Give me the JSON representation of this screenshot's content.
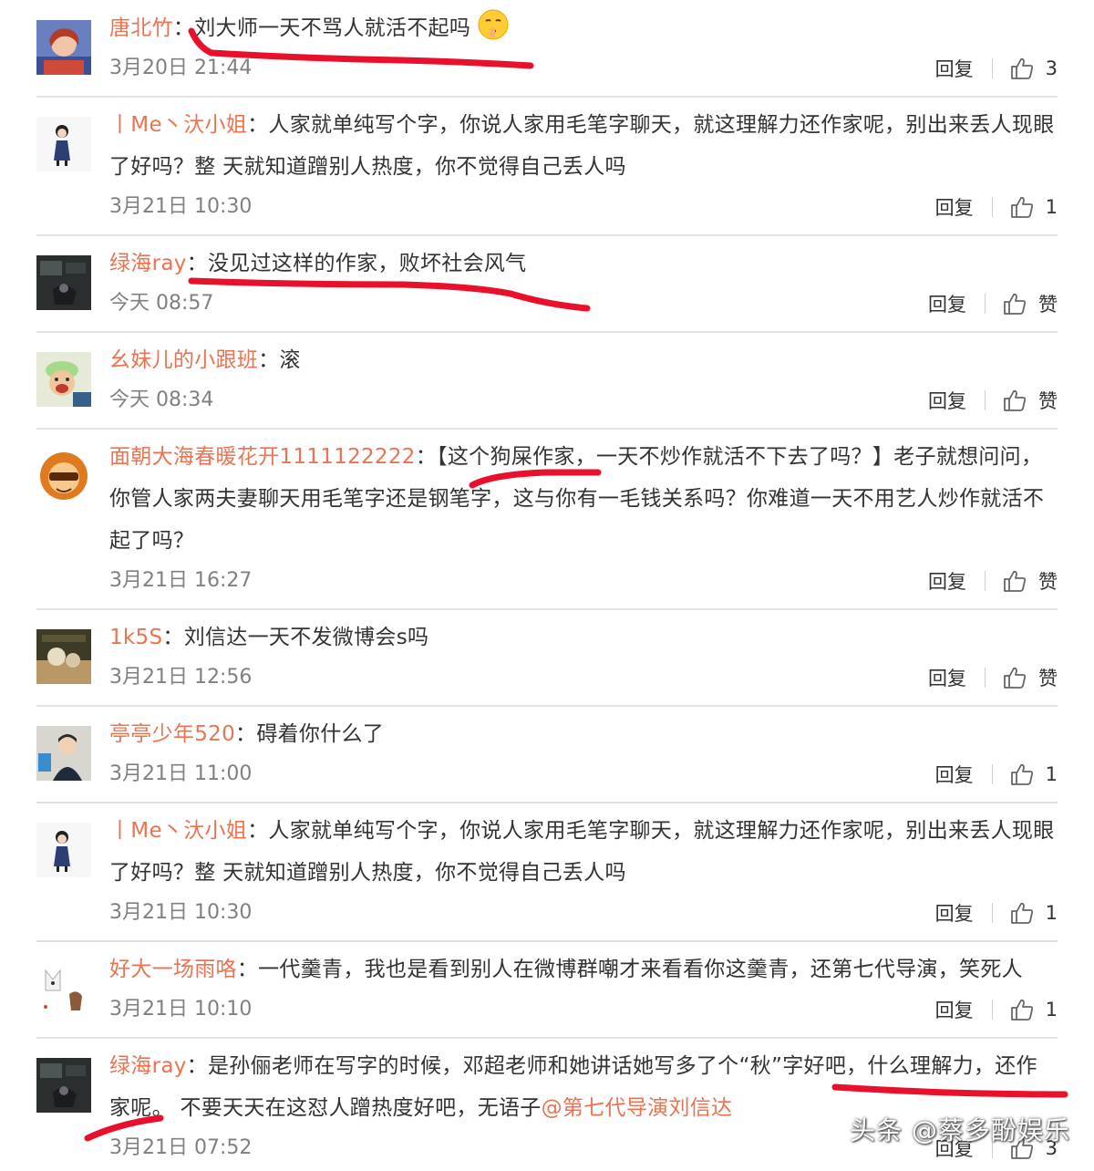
{
  "comments": [
    {
      "username": "唐北竹",
      "text": "刘大师一天不骂人就活不起吗",
      "emoji": "shushing-face-emoji",
      "time": "3月20日 21:44",
      "reply_label": "回复",
      "like_label": "3"
    },
    {
      "username": "丨Me丶汏小姐",
      "text": "人家就单纯写个字，你说人家用毛笔字聊天，就这理解力还作家呢，别出来丢人现眼了好吗？整 天就知道蹭别人热度，你不觉得自己丢人吗",
      "time": "3月21日 10:30",
      "reply_label": "回复",
      "like_label": "1"
    },
    {
      "username": "绿海ray",
      "text": "没见过这样的作家，败坏社会风气",
      "time": "今天 08:57",
      "reply_label": "回复",
      "like_label": "赞"
    },
    {
      "username": "幺妹儿的小跟班",
      "text": "滚",
      "time": "今天 08:34",
      "reply_label": "回复",
      "like_label": "赞"
    },
    {
      "username": "面朝大海春暖花开1111122222",
      "text": "【这个狗屎作家，一天不炒作就活不下去了吗？】老子就想问问，你管人家两夫妻聊天用毛笔字还是钢笔字，这与你有一毛钱关系吗？你难道一天不用艺人炒作就活不起了吗？",
      "time": "3月21日 16:27",
      "reply_label": "回复",
      "like_label": "赞"
    },
    {
      "username": "1k5S",
      "text": "刘信达一天不发微博会s吗",
      "time": "3月21日 12:56",
      "reply_label": "回复",
      "like_label": "赞"
    },
    {
      "username": "亭亭少年520",
      "text": "碍着你什么了",
      "time": "3月21日 11:00",
      "reply_label": "回复",
      "like_label": "1"
    },
    {
      "username": "丨Me丶汏小姐",
      "text": "人家就单纯写个字，你说人家用毛笔字聊天，就这理解力还作家呢，别出来丢人现眼了好吗？整 天就知道蹭别人热度，你不觉得自己丢人吗",
      "time": "3月21日 10:30",
      "reply_label": "回复",
      "like_label": "1"
    },
    {
      "username": "好大一场雨咯",
      "text": "一代羹青，我也是看到别人在微博群嘲才来看看你这羹青，还第七代导演，笑死人",
      "time": "3月21日 10:10",
      "reply_label": "回复",
      "like_label": "1"
    },
    {
      "username": "绿海ray",
      "text": "是孙俪老师在写字的时候，邓超老师和她讲话她写多了个“秋”字好吧，什么理解力，还作家呢。 不要天天在这怼人蹭热度好吧，无语子",
      "mention": "@第七代导演刘信达",
      "time": "3月21日 07:52",
      "reply_label": "回复",
      "like_label": "3"
    }
  ],
  "separator": "：",
  "watermark": "头条 @蔡多酚娱乐",
  "colors": {
    "username": "#eb7350",
    "text": "#333333",
    "time": "#808080",
    "divider": "#e2e2e2",
    "scribble": "#e8102a"
  },
  "icons": {
    "like": "thumbs-up-icon",
    "emoji": "shushing-face-emoji"
  }
}
